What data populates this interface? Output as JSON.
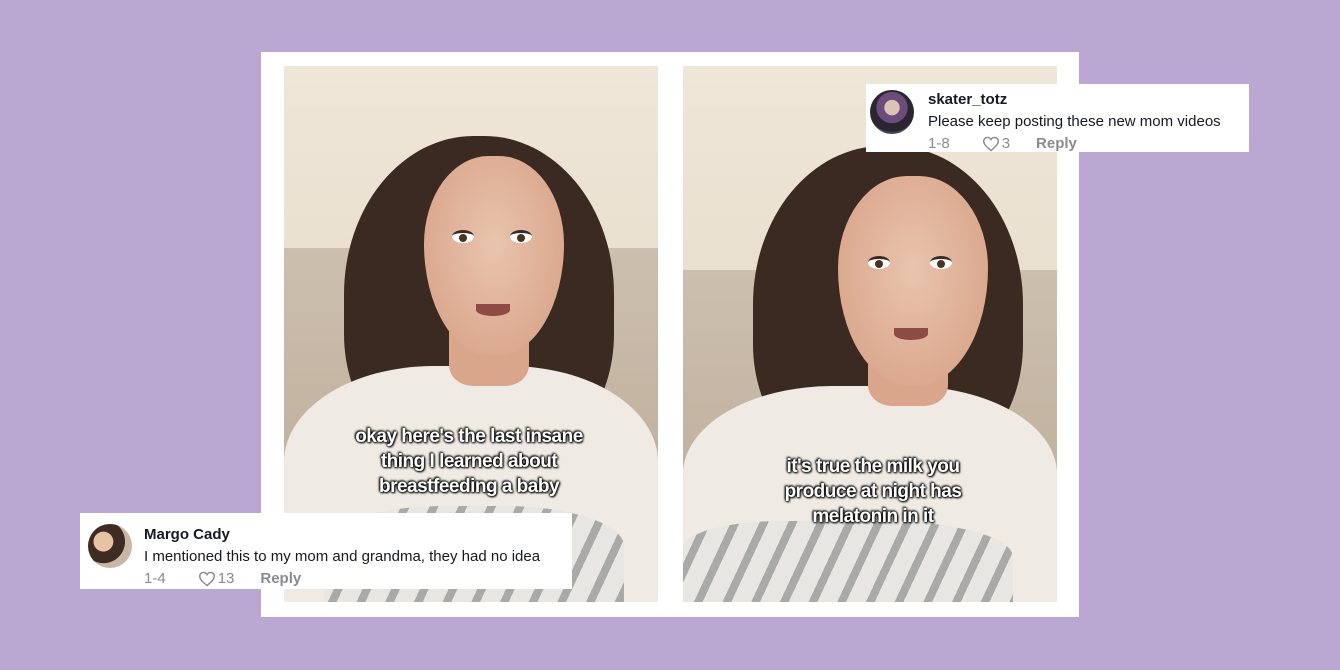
{
  "left_video": {
    "caption_lines": [
      "okay here's the last insane",
      "thing I learned about",
      "breastfeeding a baby"
    ]
  },
  "right_video": {
    "caption_lines": [
      "it's true the milk you",
      "produce at night has",
      "melatonin in it"
    ]
  },
  "comments": [
    {
      "username": "Margo Cady",
      "text": "I mentioned this to my mom and grandma, they had no idea",
      "date": "1-4",
      "likes": "13",
      "reply_label": "Reply",
      "avatar_icon": "user-avatar"
    },
    {
      "username": "skater_totz",
      "text": "Please keep posting these new mom videos",
      "date": "1-8",
      "likes": "3",
      "reply_label": "Reply",
      "avatar_icon": "user-avatar"
    }
  ],
  "colors": {
    "background": "#baa8d2",
    "card": "#ffffff",
    "caption_text": "#ffffff",
    "meta_text": "#8a8b91"
  }
}
